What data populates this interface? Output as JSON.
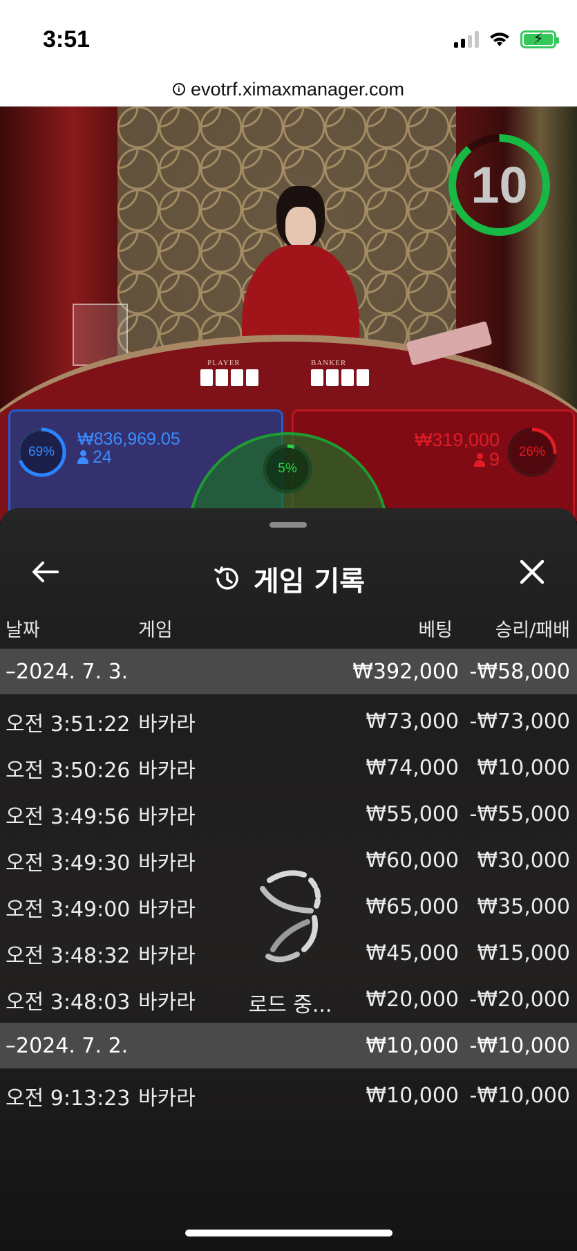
{
  "status_bar": {
    "time": "3:51"
  },
  "browser": {
    "url": "evotrf.ximaxmanager.com"
  },
  "game_view": {
    "timer": "10",
    "table_labels": {
      "player": "PLAYER",
      "banker": "BANKER"
    },
    "player_bet": {
      "percent": "69%",
      "amount": "₩836,969.05",
      "players": "24",
      "color": "#3a8cff"
    },
    "tie_bet": {
      "percent": "5%",
      "color": "#1e9c32"
    },
    "banker_bet": {
      "percent": "26%",
      "amount": "₩319,000",
      "players": "9",
      "color": "#e01c25"
    }
  },
  "history": {
    "title": "게임 기록",
    "columns": {
      "date": "날짜",
      "game": "게임",
      "bet": "베팅",
      "win_loss": "승리/패배"
    },
    "groups": [
      {
        "date": "–2024. 7. 3.",
        "total_bet": "₩392,000",
        "total_win_loss": "-₩58,000",
        "rows": [
          {
            "time": "오전 3:51:22",
            "game": "바카라",
            "bet": "₩73,000",
            "win_loss": "-₩73,000"
          },
          {
            "time": "오전 3:50:26",
            "game": "바카라",
            "bet": "₩74,000",
            "win_loss": "₩10,000"
          },
          {
            "time": "오전 3:49:56",
            "game": "바카라",
            "bet": "₩55,000",
            "win_loss": "-₩55,000"
          },
          {
            "time": "오전 3:49:30",
            "game": "바카라",
            "bet": "₩60,000",
            "win_loss": "₩30,000"
          },
          {
            "time": "오전 3:49:00",
            "game": "바카라",
            "bet": "₩65,000",
            "win_loss": "₩35,000"
          },
          {
            "time": "오전 3:48:32",
            "game": "바카라",
            "bet": "₩45,000",
            "win_loss": "₩15,000"
          },
          {
            "time": "오전 3:48:03",
            "game": "바카라",
            "bet": "₩20,000",
            "win_loss": "-₩20,000"
          }
        ]
      },
      {
        "date": "–2024. 7. 2.",
        "total_bet": "₩10,000",
        "total_win_loss": "-₩10,000",
        "rows": [
          {
            "time": "오전 9:13:23",
            "game": "바카라",
            "bet": "₩10,000",
            "win_loss": "-₩10,000"
          }
        ]
      }
    ],
    "loading_label": "로드 중..."
  }
}
